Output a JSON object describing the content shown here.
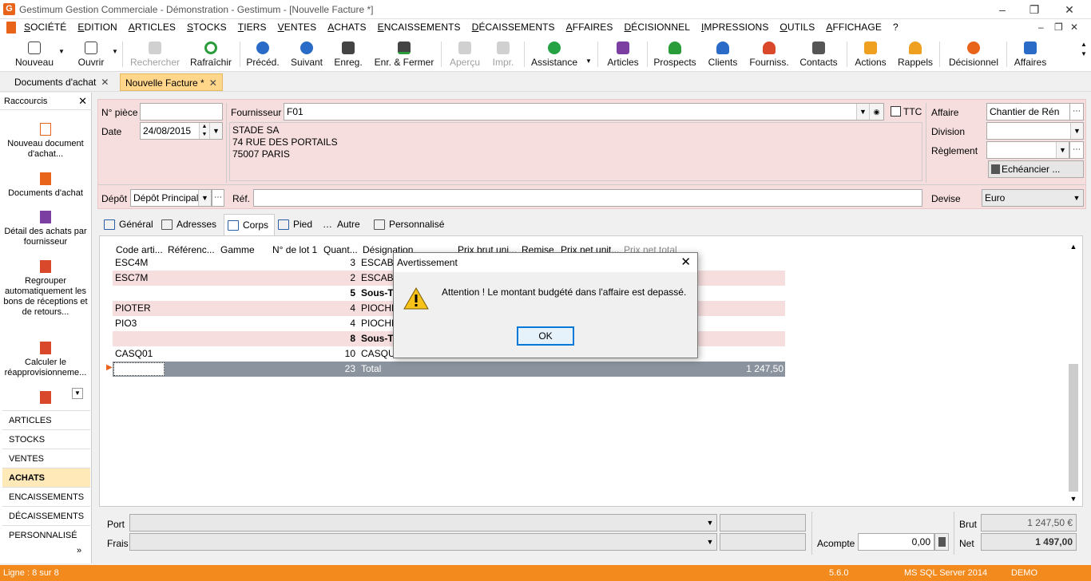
{
  "window": {
    "title": "Gestimum Gestion Commerciale - Démonstration - Gestimum - [Nouvelle Facture *]",
    "logo_letter": "G"
  },
  "menu": [
    "SOCIÉTÉ",
    "EDITION",
    "ARTICLES",
    "STOCKS",
    "TIERS",
    "VENTES",
    "ACHATS",
    "ENCAISSEMENTS",
    "DÉCAISSEMENTS",
    "AFFAIRES",
    "DÉCISIONNEL",
    "IMPRESSIONS",
    "OUTILS",
    "AFFICHAGE",
    "?"
  ],
  "toolbar": {
    "nouveau": "Nouveau",
    "ouvrir": "Ouvrir",
    "rechercher": "Rechercher",
    "rafraichir": "Rafraîchir",
    "preced": "Précéd.",
    "suivant": "Suivant",
    "enreg": "Enreg.",
    "enr_fermer": "Enr. & Fermer",
    "apercu": "Aperçu",
    "impr": "Impr.",
    "assistance": "Assistance",
    "articles": "Articles",
    "prospects": "Prospects",
    "clients": "Clients",
    "fourniss": "Fourniss.",
    "contacts": "Contacts",
    "actions": "Actions",
    "rappels": "Rappels",
    "decisionnel": "Décisionnel",
    "affaires": "Affaires"
  },
  "doc_tabs": [
    {
      "label": "Documents d'achat"
    },
    {
      "label": "Nouvelle Facture *"
    }
  ],
  "sidebar": {
    "title": "Raccourcis",
    "shortcuts": [
      "Nouveau document d'achat...",
      "Documents d'achat",
      "Détail des achats par fournisseur",
      "Regrouper automatiquement les bons de réceptions et de retours...",
      "Calculer le réapprovisionneme..."
    ],
    "modules": [
      "ARTICLES",
      "STOCKS",
      "VENTES",
      "ACHATS",
      "ENCAISSEMENTS",
      "DÉCAISSEMENTS",
      "PERSONNALISÉ"
    ]
  },
  "header": {
    "npiece_label": "N° pièce",
    "npiece_value": "",
    "date_label": "Date",
    "date_value": "24/08/2015",
    "fournisseur_label": "Fournisseur",
    "fournisseur_value": "F01",
    "ttc_label": "TTC",
    "address": [
      "STADE SA",
      "74 RUE DES PORTAILS",
      "75007 PARIS"
    ],
    "affaire_label": "Affaire",
    "affaire_value": "Chantier de Rén",
    "division_label": "Division",
    "division_value": "",
    "reglement_label": "Règlement",
    "reglement_value": "",
    "echeancier_label": "Echéancier ...",
    "depot_label": "Dépôt",
    "depot_value": "Dépôt Principal",
    "ref_label": "Réf.",
    "ref_value": "",
    "devise_label": "Devise",
    "devise_value": "Euro"
  },
  "content_tabs": [
    "Général",
    "Adresses",
    "Corps",
    "Pied",
    "Autre",
    "Personnalisé"
  ],
  "grid": {
    "columns": [
      "Code arti...",
      "Référenc...",
      "Gamme",
      "N° de lot 1",
      "Quant...",
      "Désignation",
      "Prix brut uni...",
      "Remise",
      "Prix net unit...",
      "Prix net total"
    ],
    "rows": [
      {
        "code": "ESC4M",
        "qty": "3",
        "desig": "ESCABE",
        "total": ""
      },
      {
        "code": "ESC7M",
        "qty": "2",
        "desig": "ESCABE",
        "total": ""
      },
      {
        "code": "",
        "qty": "5",
        "desig": "Sous-To",
        "total": ""
      },
      {
        "code": "PIOTER",
        "qty": "4",
        "desig": "PIOCHE",
        "total": ""
      },
      {
        "code": "PIO3",
        "qty": "4",
        "desig": "PIOCHE",
        "total": ""
      },
      {
        "code": "",
        "qty": "8",
        "desig": "Sous-To",
        "total": ""
      },
      {
        "code": "CASQ01",
        "qty": "10",
        "desig": "CASQU",
        "total": ""
      },
      {
        "code": "",
        "qty": "23",
        "desig": "Total",
        "total": "1 247,50"
      }
    ]
  },
  "bottom": {
    "port_label": "Port",
    "frais_label": "Frais",
    "acompte_label": "Acompte",
    "acompte_value": "0,00",
    "brut_label": "Brut",
    "brut_value": "1 247,50 €",
    "net_label": "Net",
    "net_value": "1 497,00"
  },
  "status": {
    "ligne": "Ligne : 8 sur 8",
    "version": "5.6.0",
    "db": "MS SQL Server 2014",
    "mode": "DEMO"
  },
  "modal": {
    "title": "Avertissement",
    "message": "Attention ! Le montant budgété dans l'affaire est depassé.",
    "ok": "OK"
  }
}
